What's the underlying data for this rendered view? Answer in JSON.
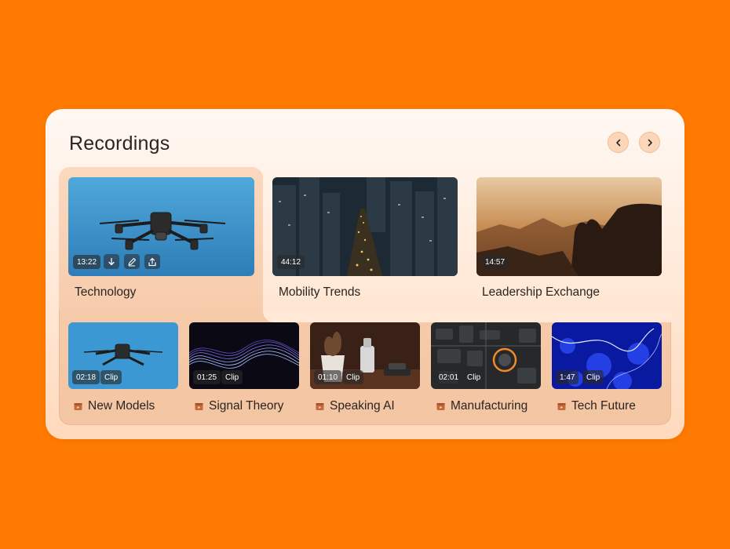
{
  "header": {
    "title": "Recordings"
  },
  "navigation": {
    "prev_icon": "chevron-left-icon",
    "next_icon": "chevron-right-icon"
  },
  "featured": [
    {
      "label": "Technology",
      "duration": "13:22",
      "selected": true,
      "actions": [
        "download-icon",
        "edit-icon",
        "share-icon"
      ]
    },
    {
      "label": "Mobility Trends",
      "duration": "44:12"
    },
    {
      "label": "Leadership Exchange",
      "duration": "14:57"
    }
  ],
  "clips": [
    {
      "label": "New Models",
      "duration": "02:18",
      "tag": "Clip"
    },
    {
      "label": "Signal Theory",
      "duration": "01:25",
      "tag": "Clip"
    },
    {
      "label": "Speaking AI",
      "duration": "01:10",
      "tag": "Clip"
    },
    {
      "label": "Manufacturing",
      "duration": "02:01",
      "tag": "Clip"
    },
    {
      "label": "Tech Future",
      "duration": "1:47",
      "tag": "Clip"
    }
  ],
  "colors": {
    "background": "#FF7A00",
    "card": "#FFF3EA",
    "selection": "#F6CBAA",
    "clip_icon": "#C8693B"
  }
}
